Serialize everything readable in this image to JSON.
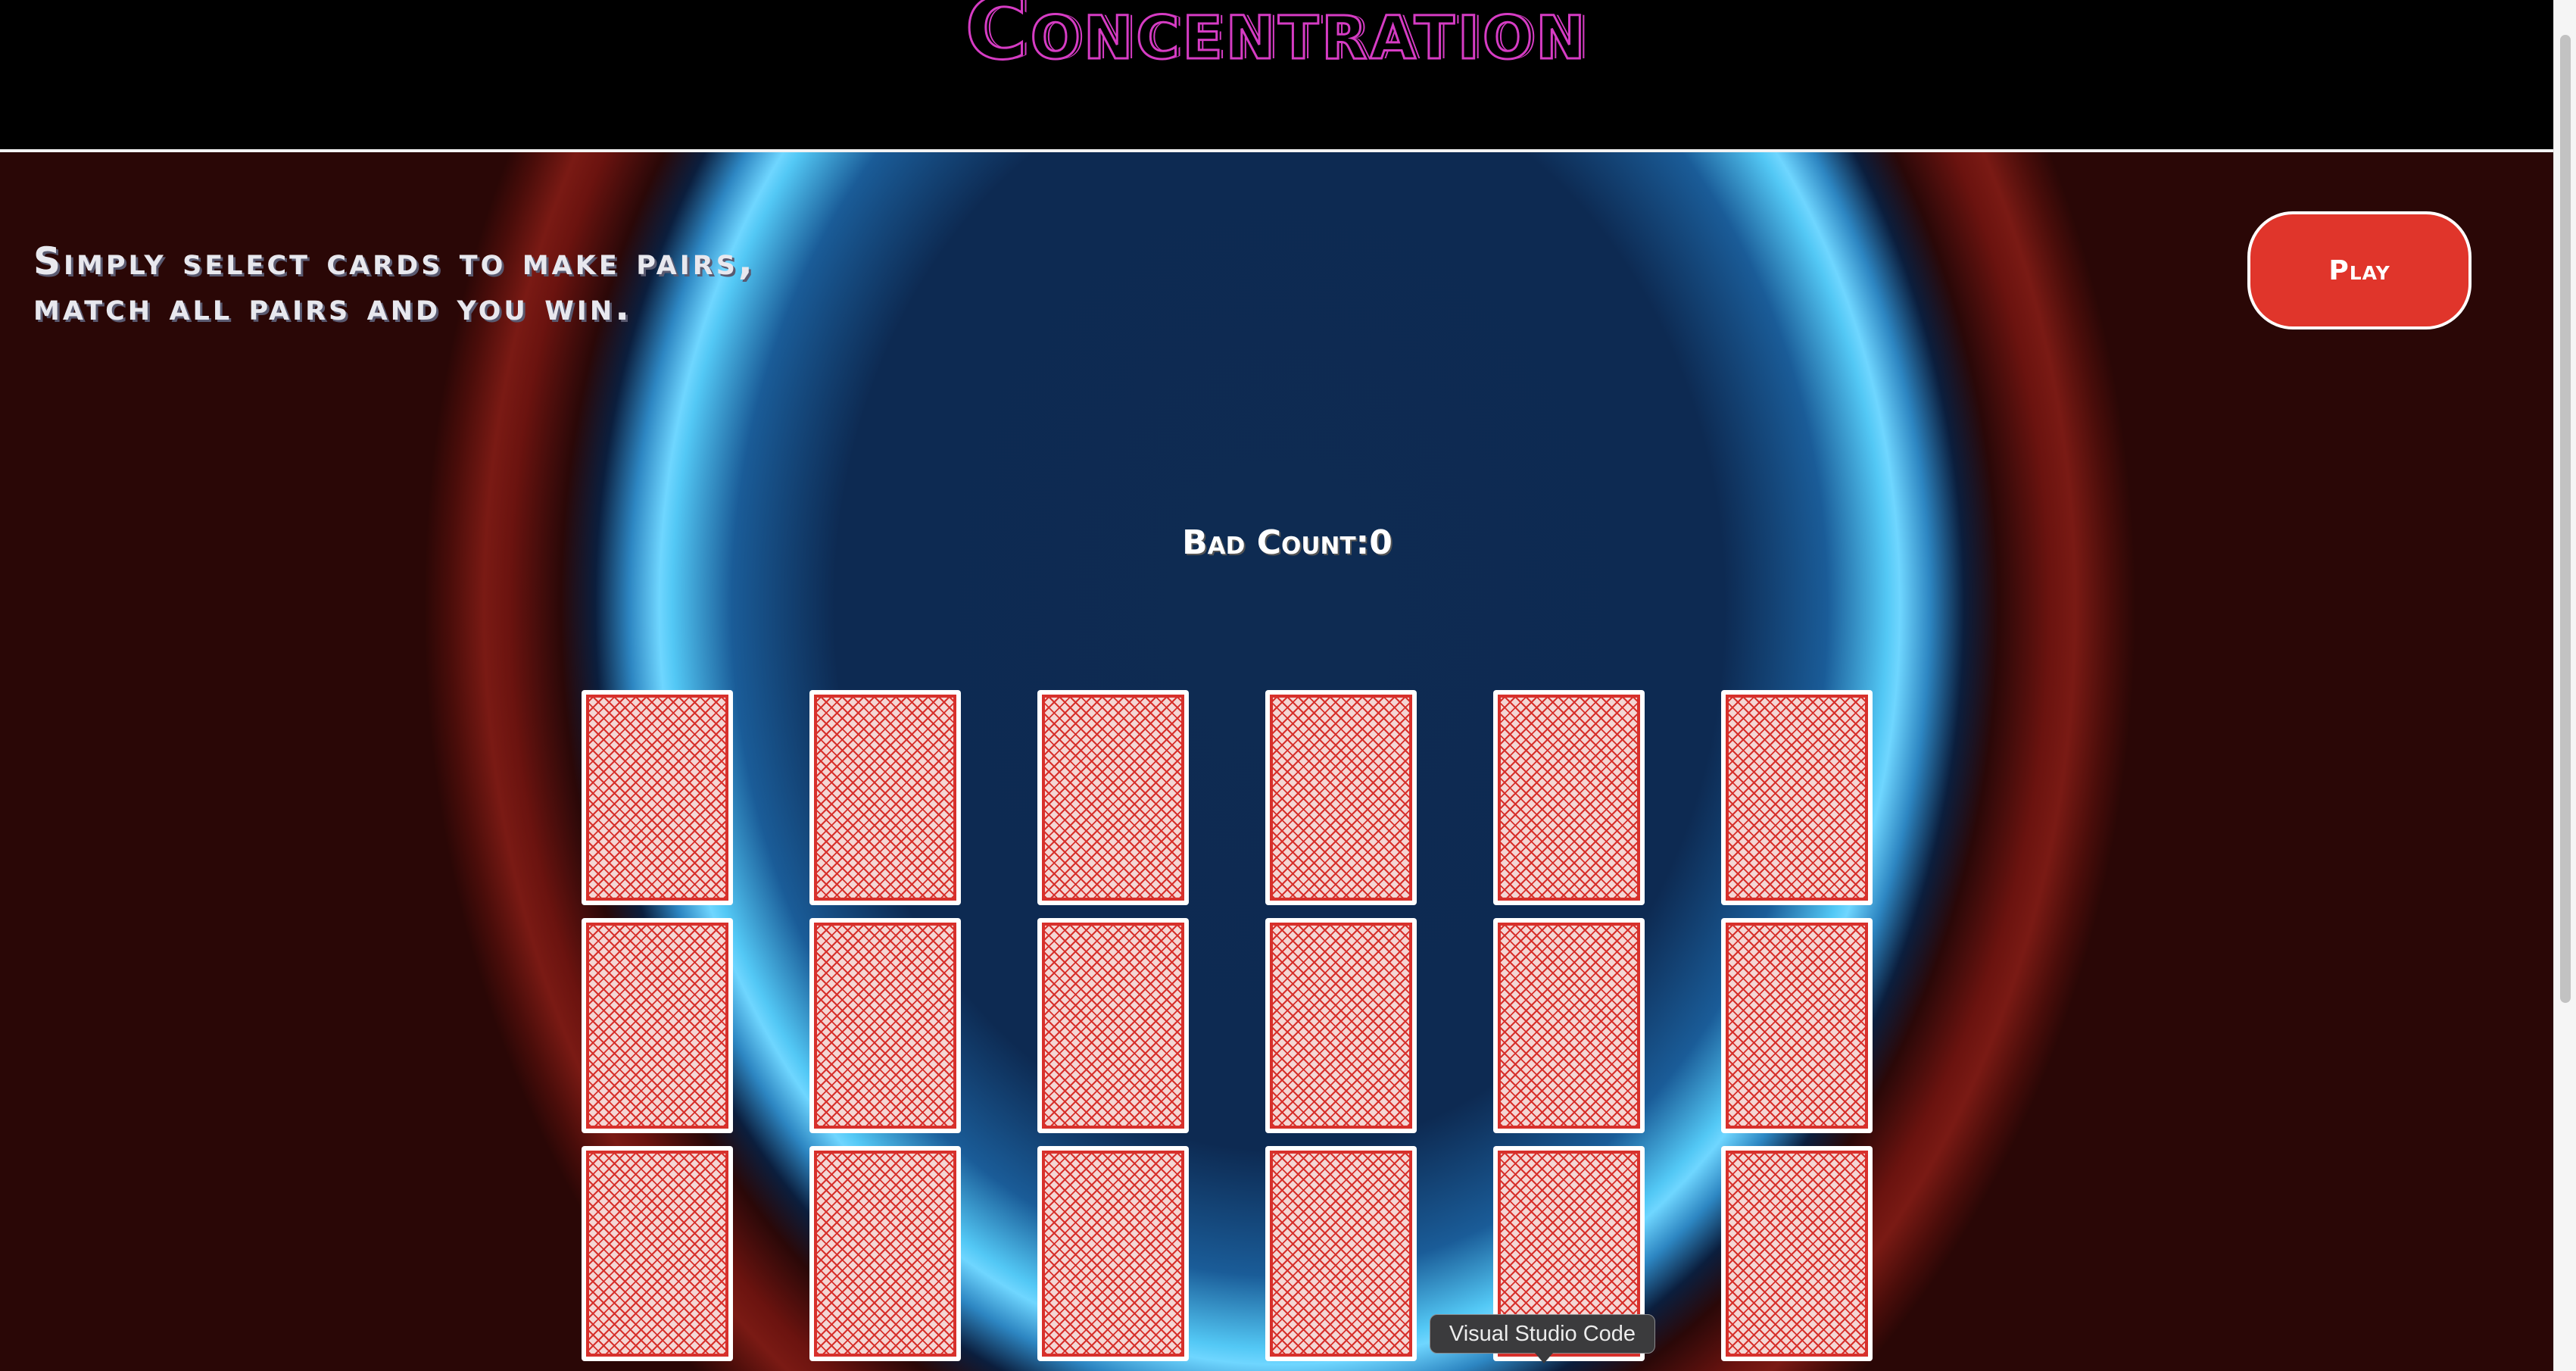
{
  "header": {
    "title": "Concentration"
  },
  "instructions": "Simply select cards to make pairs, match all pairs and you win.",
  "play_button": {
    "label": "Play"
  },
  "bad_count": {
    "label": "Bad Count:",
    "value": "0"
  },
  "board": {
    "rows": 3,
    "columns": 6,
    "cards": [
      {
        "face": "down"
      },
      {
        "face": "down"
      },
      {
        "face": "down"
      },
      {
        "face": "down"
      },
      {
        "face": "down"
      },
      {
        "face": "down"
      },
      {
        "face": "down"
      },
      {
        "face": "down"
      },
      {
        "face": "down"
      },
      {
        "face": "down"
      },
      {
        "face": "down"
      },
      {
        "face": "down"
      },
      {
        "face": "down"
      },
      {
        "face": "down"
      },
      {
        "face": "down"
      },
      {
        "face": "down"
      },
      {
        "face": "down"
      },
      {
        "face": "down"
      }
    ]
  },
  "tooltip": {
    "text": "Visual Studio Code"
  },
  "colors": {
    "title": "#d63cc4",
    "play_button": "#e0352b",
    "card_back": "#d7302b",
    "ring_glow": "#6fd6ff",
    "background_center": "#0d2a52",
    "background_edge": "#7a1a14"
  }
}
